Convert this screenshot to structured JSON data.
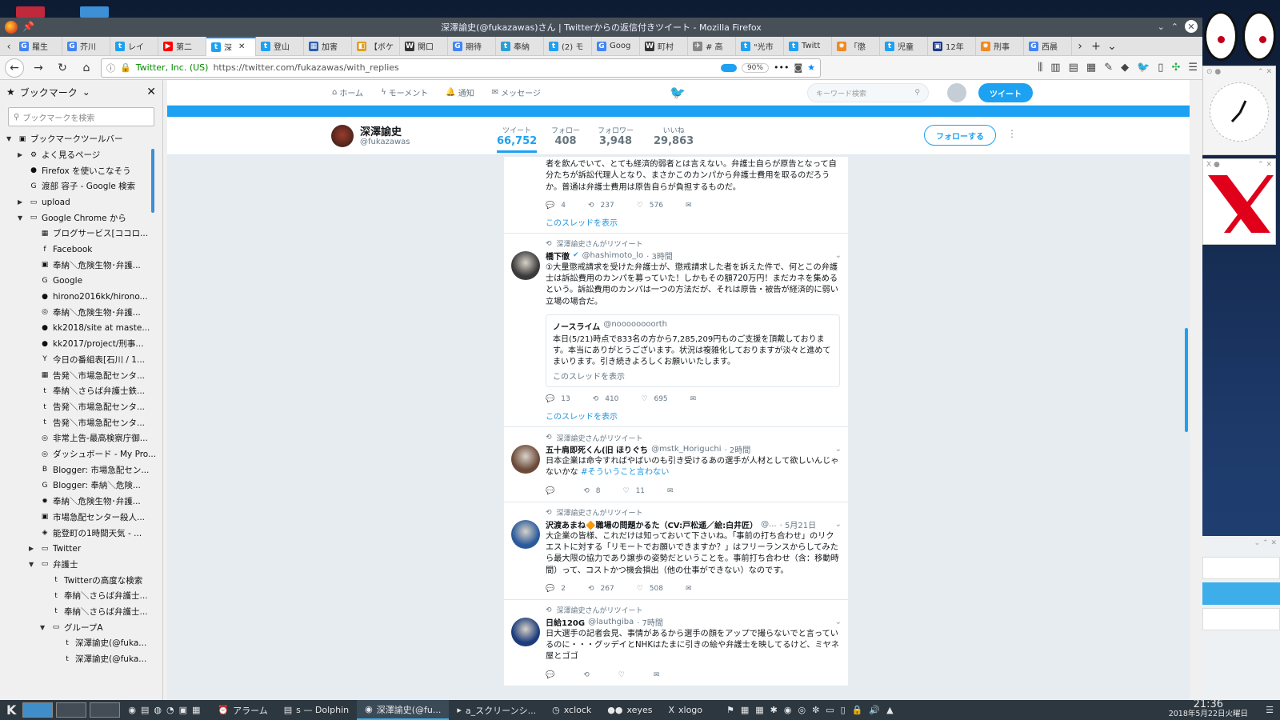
{
  "window": {
    "title": "深澤諭史(@fukazawas)さん | Twitterからの返信付きツイート - Mozilla Firefox"
  },
  "tabs": [
    {
      "label": "羅生",
      "icon": "G",
      "color": "#4285f4"
    },
    {
      "label": "芥川",
      "icon": "G",
      "color": "#4285f4"
    },
    {
      "label": "レイ",
      "icon": "t",
      "color": "#1da1f2"
    },
    {
      "label": "第二",
      "icon": "▶",
      "color": "#ff0000"
    },
    {
      "label": "深",
      "icon": "t",
      "color": "#1da1f2",
      "active": true
    },
    {
      "label": "登山",
      "icon": "t",
      "color": "#1da1f2"
    },
    {
      "label": "加害",
      "icon": "▦",
      "color": "#2a5db0"
    },
    {
      "label": "【ボケ",
      "icon": "◧",
      "color": "#e0a020"
    },
    {
      "label": "関口",
      "icon": "W",
      "color": "#333"
    },
    {
      "label": "期待",
      "icon": "G",
      "color": "#4285f4"
    },
    {
      "label": "奉納",
      "icon": "t",
      "color": "#2a9fd6"
    },
    {
      "label": "(2) モ",
      "icon": "t",
      "color": "#1da1f2"
    },
    {
      "label": "Goog",
      "icon": "G",
      "color": "#4285f4"
    },
    {
      "label": "町村",
      "icon": "W",
      "color": "#333"
    },
    {
      "label": "# 高",
      "icon": "✈",
      "color": "#888"
    },
    {
      "label": "\"光市",
      "icon": "t",
      "color": "#1da1f2"
    },
    {
      "label": "Twitt",
      "icon": "t",
      "color": "#1da1f2"
    },
    {
      "label": "「懲",
      "icon": "✹",
      "color": "#f08a24"
    },
    {
      "label": "児童",
      "icon": "t",
      "color": "#1da1f2"
    },
    {
      "label": "12年",
      "icon": "▣",
      "color": "#1a3a8a"
    },
    {
      "label": "刑事",
      "icon": "✹",
      "color": "#f08a24"
    },
    {
      "label": "西晨",
      "icon": "G",
      "color": "#4285f4"
    }
  ],
  "navbar": {
    "org": "Twitter, Inc. (US)",
    "url": "https://twitter.com/fukazawas/with_replies",
    "zoom": "90%"
  },
  "sidebar": {
    "title": "ブックマーク",
    "search_placeholder": "ブックマークを検索",
    "items": [
      {
        "label": "ブックマークツールバー",
        "indent": 0,
        "arrow": "▼",
        "icon": "▣"
      },
      {
        "label": "よく見るページ",
        "indent": 1,
        "arrow": "▶",
        "icon": "⚙"
      },
      {
        "label": "Firefox を使いこなそう",
        "indent": 1,
        "arrow": "",
        "icon": "●"
      },
      {
        "label": "渡部 容子 - Google 検索",
        "indent": 1,
        "arrow": "",
        "icon": "G"
      },
      {
        "label": "upload",
        "indent": 1,
        "arrow": "▶",
        "icon": "▭"
      },
      {
        "label": "Google Chrome から",
        "indent": 1,
        "arrow": "▼",
        "icon": "▭"
      },
      {
        "label": "ブログサービス[ココロ...",
        "indent": 2,
        "arrow": "",
        "icon": "▦"
      },
      {
        "label": "Facebook",
        "indent": 2,
        "arrow": "",
        "icon": "f"
      },
      {
        "label": "奉納＼危険生物･弁護...",
        "indent": 2,
        "arrow": "",
        "icon": "▣"
      },
      {
        "label": "Google",
        "indent": 2,
        "arrow": "",
        "icon": "G"
      },
      {
        "label": "hirono2016kk/hirono...",
        "indent": 2,
        "arrow": "",
        "icon": "●"
      },
      {
        "label": "奉納＼危険生物･弁護...",
        "indent": 2,
        "arrow": "",
        "icon": "◎"
      },
      {
        "label": "kk2018/site at maste...",
        "indent": 2,
        "arrow": "",
        "icon": "●"
      },
      {
        "label": "kk2017/project/刑事...",
        "indent": 2,
        "arrow": "",
        "icon": "●"
      },
      {
        "label": "今日の番組表[石川 / 1...",
        "indent": 2,
        "arrow": "",
        "icon": "Y"
      },
      {
        "label": "告発＼市場急配センタ...",
        "indent": 2,
        "arrow": "",
        "icon": "▦"
      },
      {
        "label": "奉納＼さらば弁護士鉄...",
        "indent": 2,
        "arrow": "",
        "icon": "t"
      },
      {
        "label": "告発＼市場急配センタ...",
        "indent": 2,
        "arrow": "",
        "icon": "t"
      },
      {
        "label": "告発＼市場急配センタ...",
        "indent": 2,
        "arrow": "",
        "icon": "t"
      },
      {
        "label": "非常上告-最高検察庁御...",
        "indent": 2,
        "arrow": "",
        "icon": "◎"
      },
      {
        "label": "ダッシュボード - My Pro...",
        "indent": 2,
        "arrow": "",
        "icon": "◎"
      },
      {
        "label": "Blogger: 市場急配セン...",
        "indent": 2,
        "arrow": "",
        "icon": "B"
      },
      {
        "label": "Blogger: 奉納＼危険...",
        "indent": 2,
        "arrow": "",
        "icon": "G"
      },
      {
        "label": "奉納＼危険生物･弁護...",
        "indent": 2,
        "arrow": "",
        "icon": "✹"
      },
      {
        "label": "市場急配センター殺人...",
        "indent": 2,
        "arrow": "",
        "icon": "▣"
      },
      {
        "label": "能登町の1時間天気 - ...",
        "indent": 2,
        "arrow": "",
        "icon": "◈"
      },
      {
        "label": "Twitter",
        "indent": 2,
        "arrow": "▶",
        "icon": "▭"
      },
      {
        "label": "弁護士",
        "indent": 2,
        "arrow": "▼",
        "icon": "▭"
      },
      {
        "label": "Twitterの高度な検索",
        "indent": 3,
        "arrow": "",
        "icon": "t"
      },
      {
        "label": "奉納＼さらば弁護士...",
        "indent": 3,
        "arrow": "",
        "icon": "t"
      },
      {
        "label": "奉納＼さらば弁護士...",
        "indent": 3,
        "arrow": "",
        "icon": "t"
      },
      {
        "label": "グループA",
        "indent": 3,
        "arrow": "▼",
        "icon": "▭"
      },
      {
        "label": "深澤諭史(@fuka...",
        "indent": 4,
        "arrow": "",
        "icon": "t"
      },
      {
        "label": "深澤諭史(@fuka...",
        "indent": 4,
        "arrow": "",
        "icon": "t"
      }
    ]
  },
  "twitter": {
    "nav": {
      "home": "ホーム",
      "moments": "モーメント",
      "notifications": "通知",
      "messages": "メッセージ"
    },
    "search_placeholder": "キーワード検索",
    "tweet_button": "ツイート",
    "profile": {
      "name": "深澤諭史",
      "handle": "@fukazawas",
      "stats": [
        {
          "label": "ツイート",
          "value": "66,752",
          "active": true
        },
        {
          "label": "フォロー",
          "value": "408"
        },
        {
          "label": "フォロワー",
          "value": "3,948"
        },
        {
          "label": "いいね",
          "value": "29,863"
        }
      ],
      "follow_button": "フォローする"
    },
    "tweets": [
      {
        "partial": true,
        "text": "者を飲んでいて、とても経済的弱者とは言えない。弁護士自らが原告となって自分たちが訴訟代理人となり、まさかこのカンパから弁護士費用を取るのだろうか。普通は弁護士費用は原告自らが負担するものだ。",
        "replies": "4",
        "retweets": "237",
        "likes": "576",
        "thread": "このスレッドを表示"
      },
      {
        "retweet_label": "深澤諭史さんがリツイート",
        "name": "橋下徹",
        "handle": "@hashimoto_lo",
        "time": "· 3時間",
        "verified": true,
        "text": "①大量懲戒請求を受けた弁護士が、懲戒請求した者を訴えた件で、何とこの弁護士は訴訟費用のカンパを募っていた！しかもその額720万円！まだカネを集めるという。訴訟費用のカンパは一つの方法だが、それは原告・被告が経済的に弱い立場の場合だ。",
        "quote": {
          "name": "ノースライム",
          "handle": "@noooooooorth",
          "text": "本日(5/21)時点で833名の方から7,285,209円ものご支援を頂戴しております。本当にありがとうございます。状況は複雑化しておりますが淡々と進めてまいります。引き続きよろしくお願いいたします。",
          "thread": "このスレッドを表示"
        },
        "replies": "13",
        "retweets": "410",
        "likes": "695",
        "thread": "このスレッドを表示"
      },
      {
        "retweet_label": "深澤諭史さんがリツイート",
        "name": "五十肩即死くん(旧 ほりぐち",
        "handle": "@mstk_Horiguchi",
        "time": "· 2時間",
        "text": "日本企業は命令すればやばいのも引き受けるあの選手が人材として欲しいんじゃないかな",
        "hashtag": "#そういうこと言わない",
        "replies": "",
        "retweets": "8",
        "likes": "11"
      },
      {
        "retweet_label": "深澤諭史さんがリツイート",
        "name": "沢渡あまね🔶職場の問題かるた（CV:戸松遥／絵:白井匠）",
        "handle": "@...",
        "time": "· 5月21日",
        "text": "大企業の皆様、これだけは知っておいて下さいね。「事前の打ち合わせ」のリクエストに対する「リモートでお願いできますか？」はフリーランスからしてみたら最大限の協力であり譲歩の姿勢だということを。事前打ち合わせ（含：移動時間）って、コストかつ機会損出（他の仕事ができない）なのです。",
        "replies": "2",
        "retweets": "267",
        "likes": "508"
      },
      {
        "retweet_label": "深澤諭史さんがリツイート",
        "name": "日給120G",
        "handle": "@lauthgiba",
        "time": "· 7時間",
        "text": "日大選手の記者会見、事情があるから選手の顔をアップで撮らないでと言っているのに・・・グッデイとNHKはたまに引きの絵や弁護士を映してるけど、ミヤネ屋とゴゴ",
        "replies": "",
        "retweets": "",
        "likes": ""
      }
    ]
  },
  "taskbar": {
    "items": [
      {
        "label": "アラーム",
        "icon": "⏰"
      },
      {
        "label": "s — Dolphin",
        "icon": "▤"
      },
      {
        "label": "深澤諭史(@fu...",
        "icon": "◉",
        "active": true
      },
      {
        "label": "a_スクリーンシ...",
        "icon": "▸"
      },
      {
        "label": "xclock",
        "icon": "◷"
      },
      {
        "label": "xeyes",
        "icon": "●●"
      },
      {
        "label": "xlogo",
        "icon": "X"
      }
    ],
    "time": "21:36",
    "date": "2018年5月22日火曜日"
  },
  "colors": {
    "twitter_blue": "#1da1f2",
    "firefox_titlebar": "#475057",
    "taskbar": "#2c3740"
  }
}
